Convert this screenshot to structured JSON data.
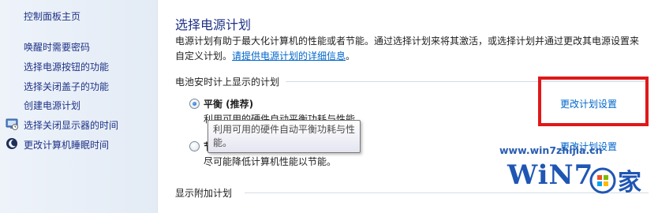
{
  "sidebar": {
    "home": "控制面板主页",
    "items": [
      {
        "label": "唤醒时需要密码",
        "icon": ""
      },
      {
        "label": "选择电源按钮的功能",
        "icon": ""
      },
      {
        "label": "选择关闭盖子的功能",
        "icon": ""
      },
      {
        "label": "创建电源计划",
        "icon": ""
      },
      {
        "label": "选择关闭显示器的时间",
        "icon": "monitor-icon"
      },
      {
        "label": "更改计算机睡眠时间",
        "icon": "moon-icon"
      }
    ]
  },
  "main": {
    "title": "选择电源计划",
    "description": "电源计划有助于最大化计算机的性能或者节能。通过选择计划来将其激活，或选择计划并通过更改其电源设置来自定义计划。",
    "description_link": "请提供电源计划的详细信息",
    "description_end": "。",
    "battery_group_label": "电池安时计上显示的计划",
    "plans": [
      {
        "name": "平衡 (推荐)",
        "description": "利用可用的硬件自动平衡功耗与性能。",
        "selected": true,
        "change_link": "更改计划设置"
      },
      {
        "name": "节",
        "description": "尽可能降低计算机性能以节能。",
        "selected": false,
        "change_link": "更改计划设置"
      }
    ],
    "additional_group_label": "显示附加计划"
  },
  "tooltip": {
    "line1": "利用可用的硬件自动平衡功耗与性",
    "line2": "能。"
  },
  "watermark": {
    "url": "www.win7zhijia.cn",
    "logo": "WiN7.",
    "jia": "家"
  },
  "colors": {
    "link": "#0066cc",
    "sidebar_text": "#1e3287",
    "highlight": "#e01818"
  }
}
